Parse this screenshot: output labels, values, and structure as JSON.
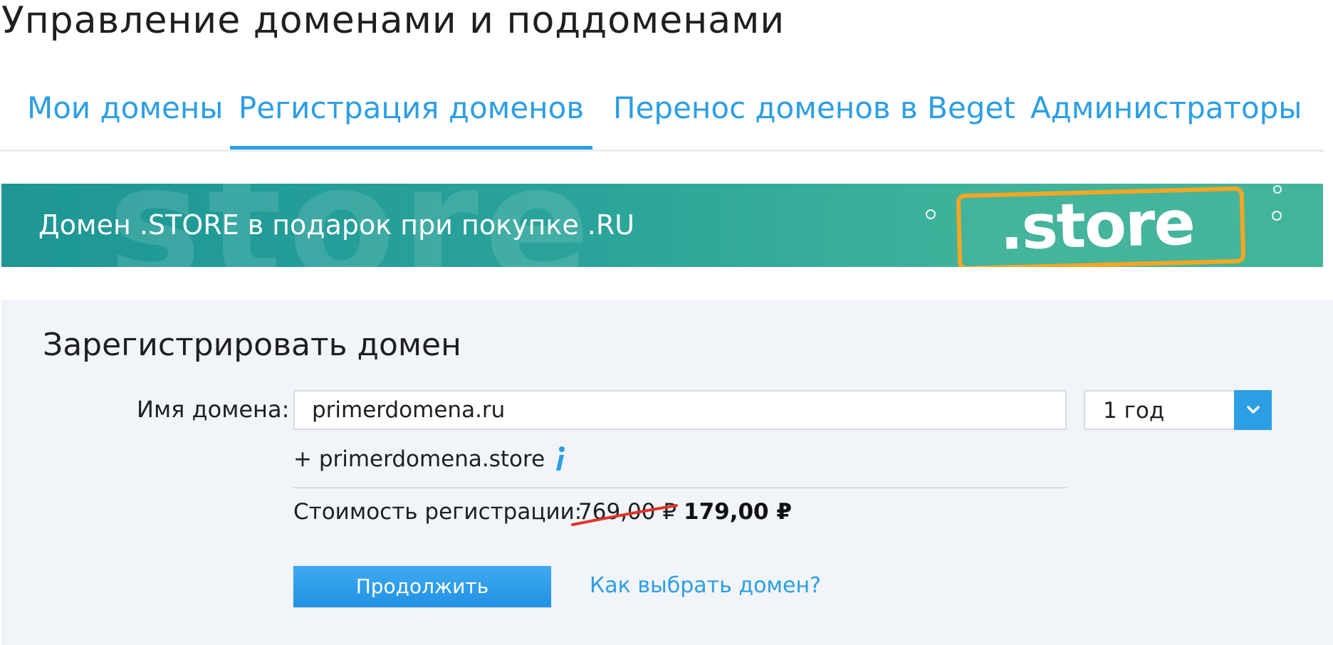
{
  "page": {
    "title": "Управление доменами и поддоменами"
  },
  "tabs": {
    "items": [
      {
        "label": "Мои домены",
        "active": false
      },
      {
        "label": "Регистрация доменов",
        "active": true
      },
      {
        "label": "Перенос доменов в Beget",
        "active": false
      },
      {
        "label": "Администраторы",
        "active": false
      }
    ]
  },
  "promo": {
    "text": "Домен .STORE в подарок при покупке .RU",
    "watermark": "store",
    "sign": ".store"
  },
  "registration": {
    "title": "Зарегистрировать домен",
    "domain_label": "Имя домена:",
    "domain_value": "primerdomena.ru",
    "period_value": "1 год",
    "bonus_domain": "+ primerdomena.store",
    "price_label": "Стоимость регистрации:",
    "old_price": "769,00 ₽",
    "new_price": "179,00 ₽",
    "continue_label": "Продолжить",
    "help_link": "Как выбрать домен?"
  },
  "icons": {
    "select_arrow": "chevron-down-icon",
    "info": "info-icon",
    "strike": "strike-line"
  },
  "colors": {
    "accent": "#2c9ee4",
    "promo_teal": "#1d9695",
    "promo_green": "#42b49a",
    "promo_orange": "#f5a623",
    "form_background": "#f1f4f8",
    "strike_red": "#e2332a"
  }
}
